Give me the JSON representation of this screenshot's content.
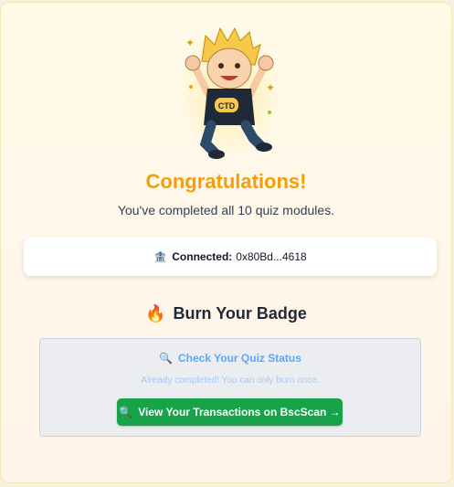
{
  "mascot": {
    "shirt_text": "CTD",
    "icon": "mascot-illustration"
  },
  "header": {
    "title": "Congratulations!",
    "subtitle": "You've completed all 10 quiz modules."
  },
  "wallet": {
    "icon": "bank-icon",
    "label": "Connected:",
    "address": "0x80Bd...4618"
  },
  "burn": {
    "icon": "fire-icon",
    "heading": "Burn Your Badge",
    "check_status_label": "Check Your Quiz Status",
    "status_message": "Already completed! You can only burn once.",
    "view_tx_button": "View Your Transactions on BscScan →"
  },
  "colors": {
    "title": "#f59e0b",
    "button": "#16a34a",
    "link": "#60a5fa"
  }
}
